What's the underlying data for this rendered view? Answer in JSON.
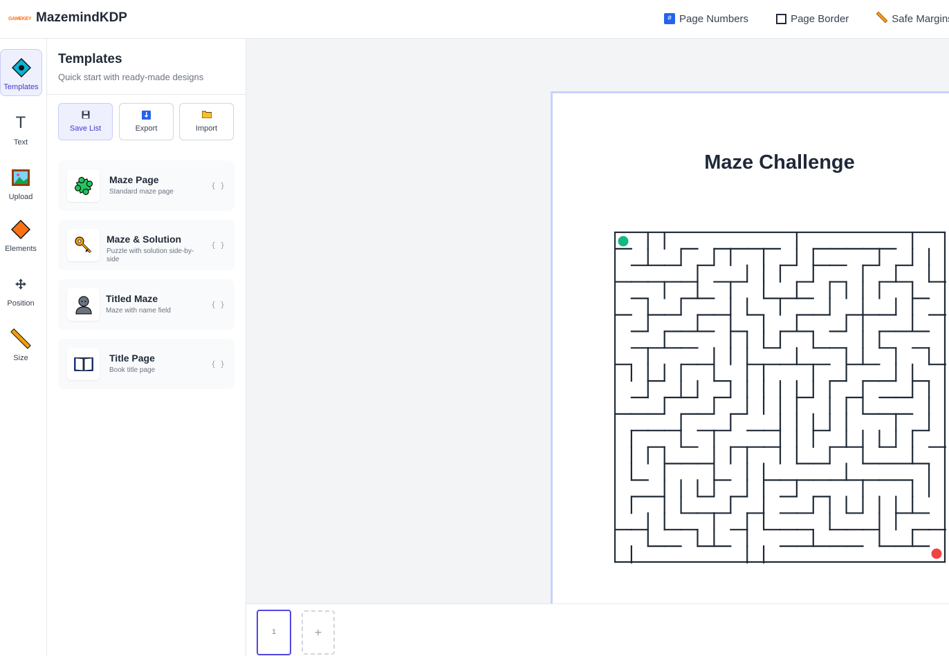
{
  "app": {
    "logo_text": "GAMEKEY",
    "title": "MazemindKDP"
  },
  "toolbar": {
    "actions": [
      {
        "label": "Page Numbers",
        "icon": "hash-icon"
      },
      {
        "label": "Page Border",
        "icon": "square-icon"
      },
      {
        "label": "Safe Margins",
        "icon": "ruler-icon"
      }
    ]
  },
  "rail": {
    "items": [
      {
        "label": "Templates",
        "icon": "diamond-target-icon",
        "active": true
      },
      {
        "label": "Text",
        "icon": "text-icon"
      },
      {
        "label": "Upload",
        "icon": "picture-icon"
      },
      {
        "label": "Elements",
        "icon": "orange-diamond-icon"
      },
      {
        "label": "Position",
        "icon": "move-arrows-icon"
      },
      {
        "label": "Size",
        "icon": "ruler-icon"
      }
    ]
  },
  "panel": {
    "title": "Templates",
    "subtitle": "Quick start with ready-made designs",
    "buttons": [
      {
        "label": "Save List",
        "icon": "floppy-icon",
        "active": true
      },
      {
        "label": "Export",
        "icon": "download-icon"
      },
      {
        "label": "Import",
        "icon": "folder-icon"
      }
    ],
    "templates": [
      {
        "name": "Maze Page",
        "desc": "Standard maze page",
        "icon": "puzzle-icon",
        "braces": "{ }"
      },
      {
        "name": "Maze & Solution",
        "desc": "Puzzle with solution side-by-side",
        "icon": "key-icon",
        "braces": "{ }"
      },
      {
        "name": "Titled Maze",
        "desc": "Maze with name field",
        "icon": "person-icon",
        "braces": "{ }"
      },
      {
        "name": "Title Page",
        "desc": "Book title page",
        "icon": "book-icon",
        "braces": "{ }"
      }
    ]
  },
  "canvas": {
    "page_title": "Maze Challenge",
    "start_color": "#10b981",
    "end_color": "#ef4444"
  },
  "pages": {
    "current": "1",
    "add_label": "+"
  }
}
